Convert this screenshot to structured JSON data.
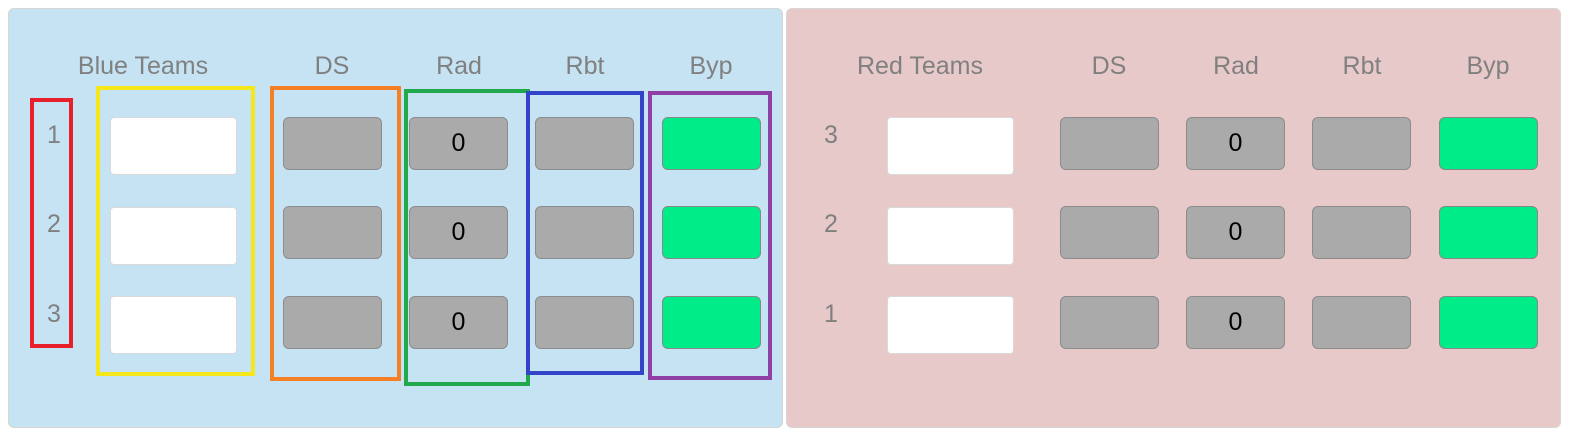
{
  "blue": {
    "headers": {
      "teams": "Blue Teams",
      "ds": "DS",
      "rad": "Rad",
      "rbt": "Rbt",
      "byp": "Byp"
    },
    "rows": [
      {
        "position": "1",
        "team": "",
        "rad": "0"
      },
      {
        "position": "2",
        "team": "",
        "rad": "0"
      },
      {
        "position": "3",
        "team": "",
        "rad": "0"
      }
    ]
  },
  "red": {
    "headers": {
      "teams": "Red Teams",
      "ds": "DS",
      "rad": "Rad",
      "rbt": "Rbt",
      "byp": "Byp"
    },
    "rows": [
      {
        "position": "3",
        "team": "",
        "rad": "0"
      },
      {
        "position": "2",
        "team": "",
        "rad": "0"
      },
      {
        "position": "1",
        "team": "",
        "rad": "0"
      }
    ]
  },
  "colors": {
    "blue_panel": "#c5e3f3",
    "red_panel": "#e8c9ca",
    "toggle_off": "#aaaaaa",
    "bypass_on": "#00ec89",
    "highlight_position": "#e8202a",
    "highlight_teams": "#f4e81c",
    "highlight_ds": "#f57f25",
    "highlight_rad": "#22a94c",
    "highlight_rbt": "#3444c8",
    "highlight_byp": "#8f3fa6"
  }
}
